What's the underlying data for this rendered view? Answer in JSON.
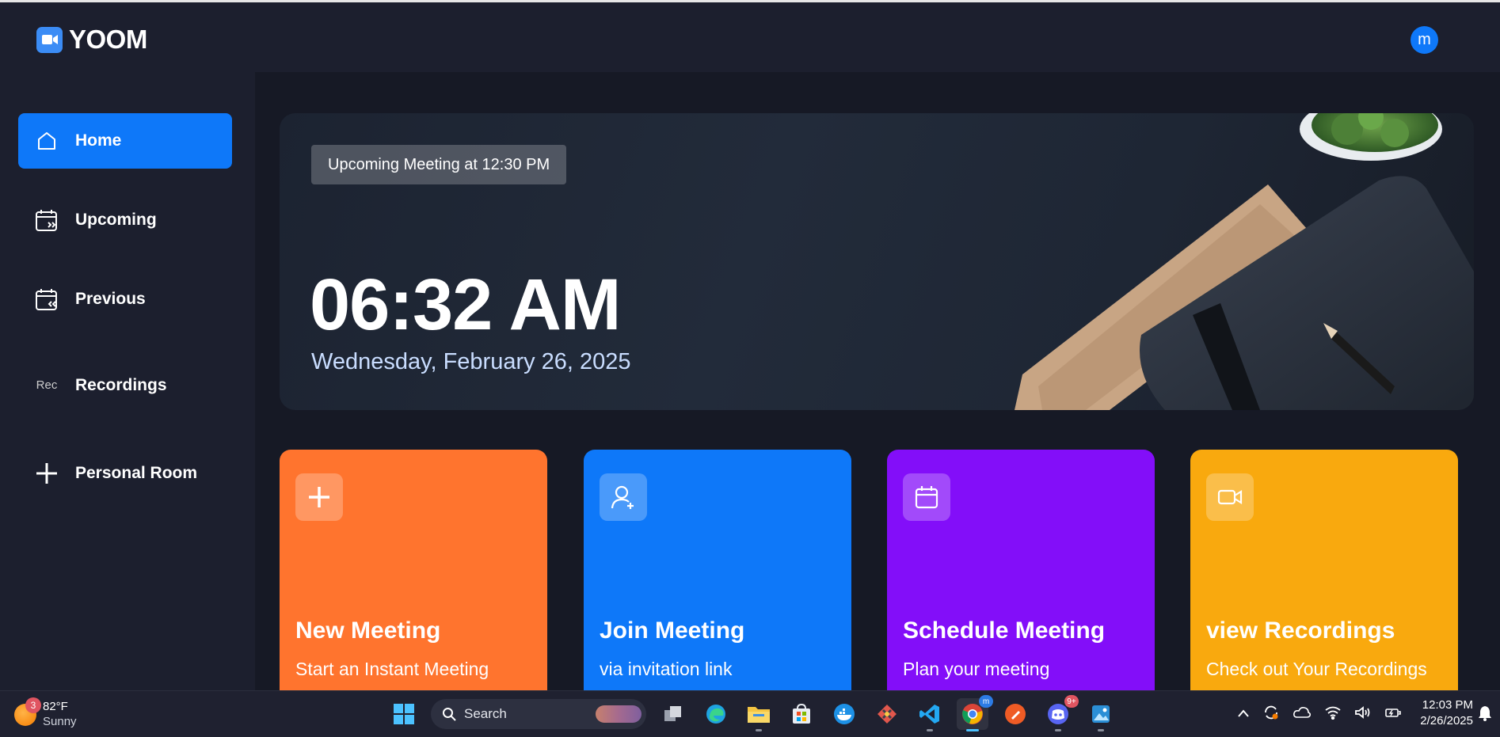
{
  "app": {
    "name": "YOOM"
  },
  "user": {
    "initial": "m"
  },
  "sidebar": {
    "items": [
      {
        "label": "Home",
        "icon": "home-icon",
        "active": true
      },
      {
        "label": "Upcoming",
        "icon": "calendar-forward-icon",
        "active": false
      },
      {
        "label": "Previous",
        "icon": "calendar-back-icon",
        "active": false
      },
      {
        "label": "Recordings",
        "icon": "broken-image-icon",
        "alt_text": "Rec",
        "active": false
      },
      {
        "label": "Personal Room",
        "icon": "plus-icon",
        "active": false
      }
    ]
  },
  "hero": {
    "badge": "Upcoming Meeting at 12:30 PM",
    "time": "06:32 AM",
    "date": "Wednesday, February 26, 2025"
  },
  "cards": [
    {
      "title": "New Meeting",
      "subtitle": "Start an Instant Meeting",
      "icon": "plus-icon",
      "color": "#ff742e"
    },
    {
      "title": "Join Meeting",
      "subtitle": "via invitation link",
      "icon": "add-user-icon",
      "color": "#0e78f9"
    },
    {
      "title": "Schedule Meeting",
      "subtitle": "Plan your meeting",
      "icon": "calendar-icon",
      "color": "#830ef9"
    },
    {
      "title": "view Recordings",
      "subtitle": "Check out Your Recordings",
      "icon": "video-icon",
      "color": "#f9a90e"
    }
  ],
  "taskbar": {
    "weather": {
      "temp": "82°F",
      "condition": "Sunny",
      "badge": "3"
    },
    "search_placeholder": "Search",
    "discord_badge": "9+",
    "chrome_badge": "m",
    "clock": {
      "time": "12:03 PM",
      "date": "2/26/2025"
    }
  },
  "colors": {
    "background": "#1c1f2e",
    "main_background": "#161925",
    "accent_blue": "#0e78f9"
  }
}
